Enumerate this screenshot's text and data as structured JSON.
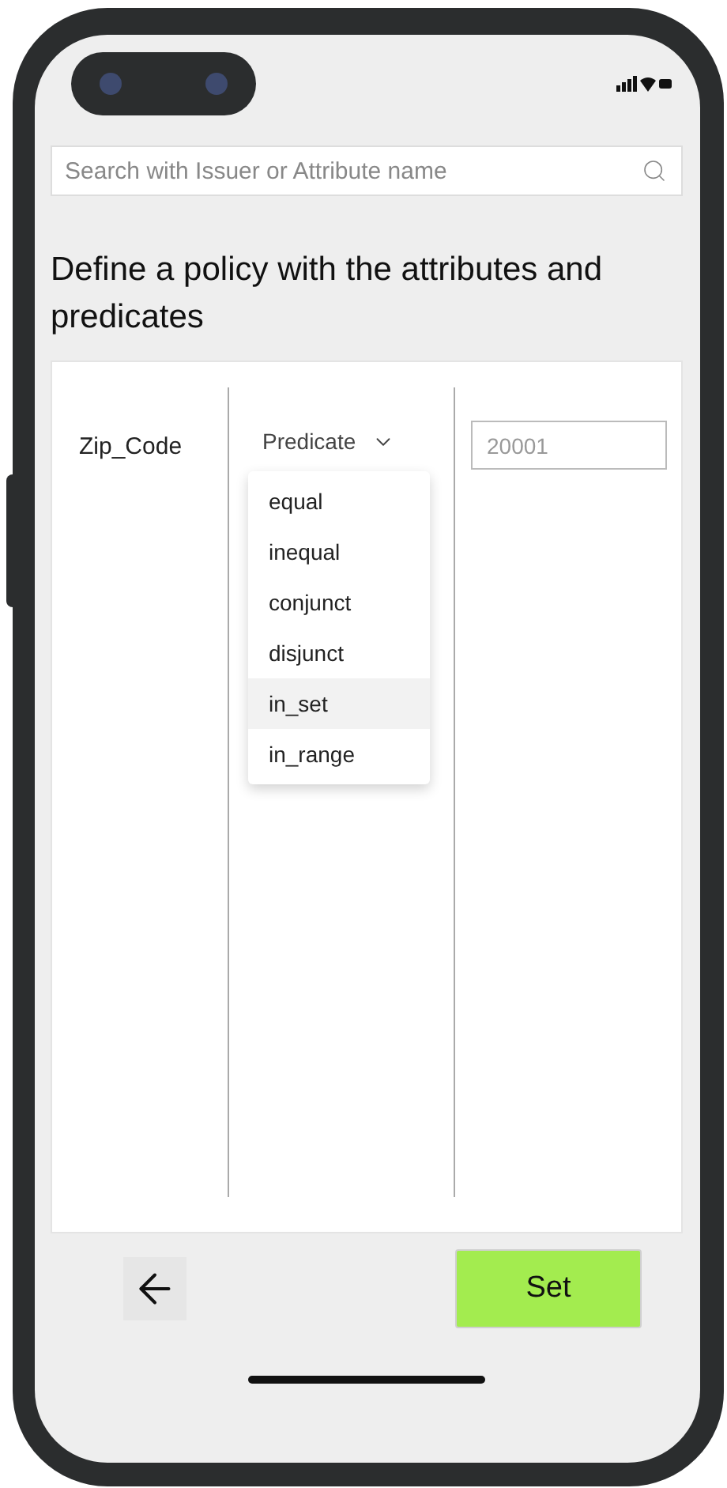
{
  "search": {
    "placeholder": "Search with Issuer or Attribute name"
  },
  "heading": "Define a policy with the attributes and predicates",
  "policy_row": {
    "attribute": "Zip_Code",
    "predicate": {
      "label": "Predicate",
      "expanded": true,
      "options": [
        {
          "label": "equal",
          "selected": false
        },
        {
          "label": "inequal",
          "selected": false
        },
        {
          "label": "conjunct",
          "selected": false
        },
        {
          "label": "disjunct",
          "selected": false
        },
        {
          "label": "in_set",
          "selected": true
        },
        {
          "label": "in_range",
          "selected": false
        }
      ]
    },
    "value": {
      "placeholder": "20001"
    }
  },
  "buttons": {
    "set": "Set"
  }
}
